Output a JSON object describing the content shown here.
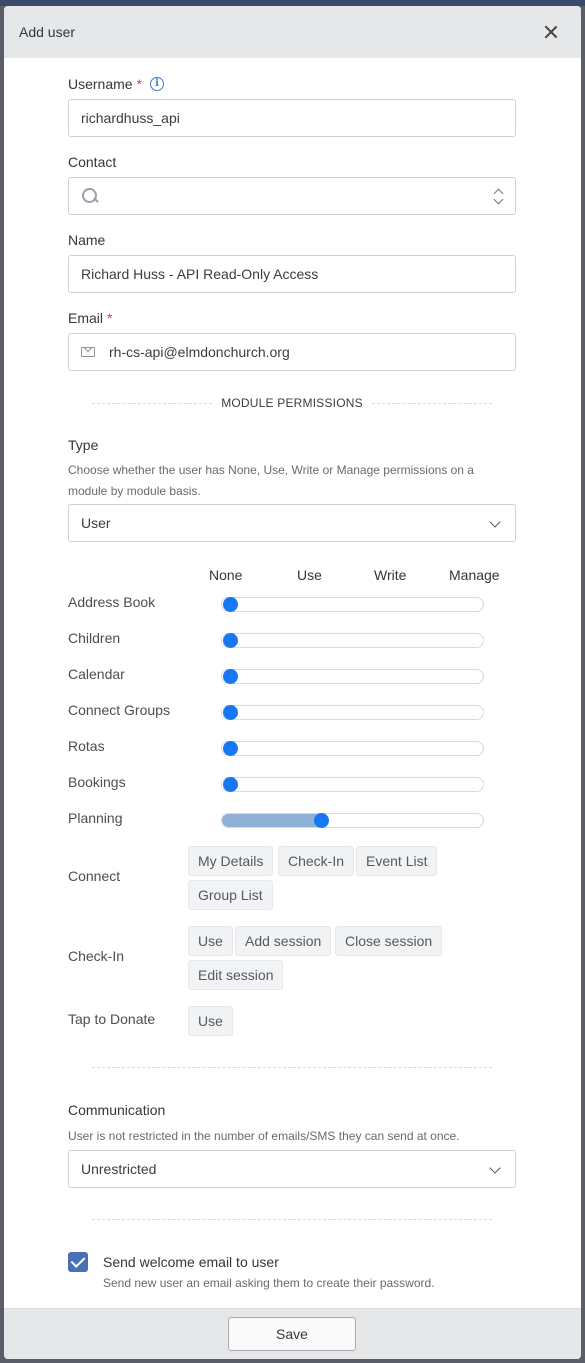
{
  "modal": {
    "title": "Add user"
  },
  "fields": {
    "username": {
      "label": "Username",
      "required_mark": "*",
      "value": "richardhuss_api"
    },
    "contact": {
      "label": "Contact",
      "value": ""
    },
    "name": {
      "label": "Name",
      "value": "Richard Huss - API Read-Only Access"
    },
    "email": {
      "label": "Email",
      "required_mark": "*",
      "value": "rh-cs-api@elmdonchurch.org"
    }
  },
  "module_permissions": {
    "section_title": "MODULE PERMISSIONS",
    "type_label": "Type",
    "type_help": "Choose whether the user has None, Use, Write or Manage permissions on a module by module basis.",
    "type_value": "User",
    "levels": [
      "None",
      "Use",
      "Write",
      "Manage"
    ],
    "modules": [
      {
        "label": "Address Book",
        "level": 0
      },
      {
        "label": "Children",
        "level": 0
      },
      {
        "label": "Calendar",
        "level": 0
      },
      {
        "label": "Connect Groups",
        "level": 0
      },
      {
        "label": "Rotas",
        "level": 0
      },
      {
        "label": "Bookings",
        "level": 0
      },
      {
        "label": "Planning",
        "level": 1
      }
    ],
    "connect": {
      "label": "Connect",
      "chips": [
        "My Details",
        "Check-In",
        "Event List",
        "Group List"
      ]
    },
    "checkin": {
      "label": "Check-In",
      "chips": [
        "Use",
        "Add session",
        "Close session",
        "Edit session"
      ]
    },
    "tap": {
      "label": "Tap to Donate",
      "chips": [
        "Use"
      ]
    }
  },
  "communication": {
    "label": "Communication",
    "help": "User is not restricted in the number of emails/SMS they can send at once.",
    "value": "Unrestricted"
  },
  "welcome": {
    "label": "Send welcome email to user",
    "help": "Send new user an email asking them to create their password.",
    "checked": true
  },
  "footer": {
    "save_label": "Save"
  },
  "colors": {
    "accent": "#1878f3",
    "checkbox": "#4a6fb5",
    "required": "#e0405a"
  }
}
